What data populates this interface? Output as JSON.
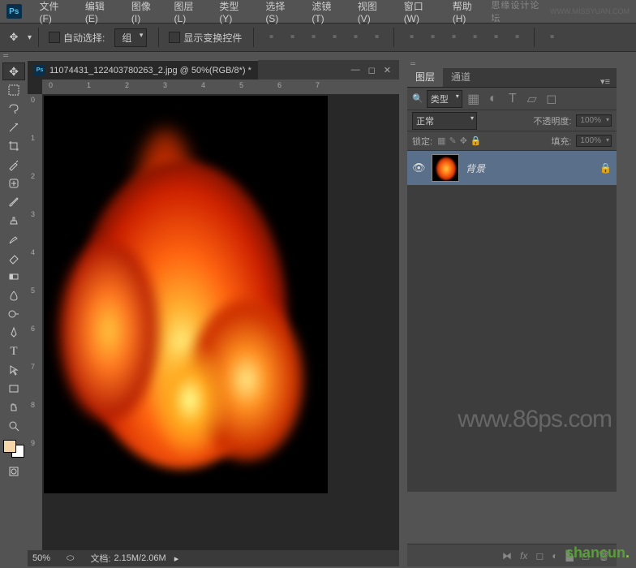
{
  "menu": {
    "items": [
      "文件(F)",
      "编辑(E)",
      "图像(I)",
      "图层(L)",
      "类型(Y)",
      "选择(S)",
      "滤镜(T)",
      "视图(V)",
      "窗口(W)",
      "帮助(H)"
    ],
    "brand": "思缘设计论坛",
    "brand_url": "WWW.MISSYUAN.COM"
  },
  "options": {
    "auto_select": "自动选择:",
    "group": "组",
    "show_transform": "显示变换控件"
  },
  "document": {
    "tab_title": "11074431_122403780263_2.jpg @ 50%(RGB/8*) *",
    "zoom": "50%",
    "doc_info_label": "文档:",
    "doc_info": "2.15M/2.06M"
  },
  "ruler_h": [
    "0",
    "1",
    "2",
    "3",
    "4",
    "5",
    "6",
    "7"
  ],
  "ruler_v": [
    "0",
    "1",
    "2",
    "3",
    "4",
    "5",
    "6",
    "7",
    "8",
    "9"
  ],
  "panels": {
    "tabs": [
      "图层",
      "通道"
    ],
    "filter_label": "类型",
    "blend_mode": "正常",
    "opacity_label": "不透明度:",
    "opacity_value": "100%",
    "lock_label": "锁定:",
    "fill_label": "填充:",
    "fill_value": "100%",
    "layer_name": "背景"
  },
  "watermark": "www.86ps.com",
  "site_watermark": "shancun"
}
